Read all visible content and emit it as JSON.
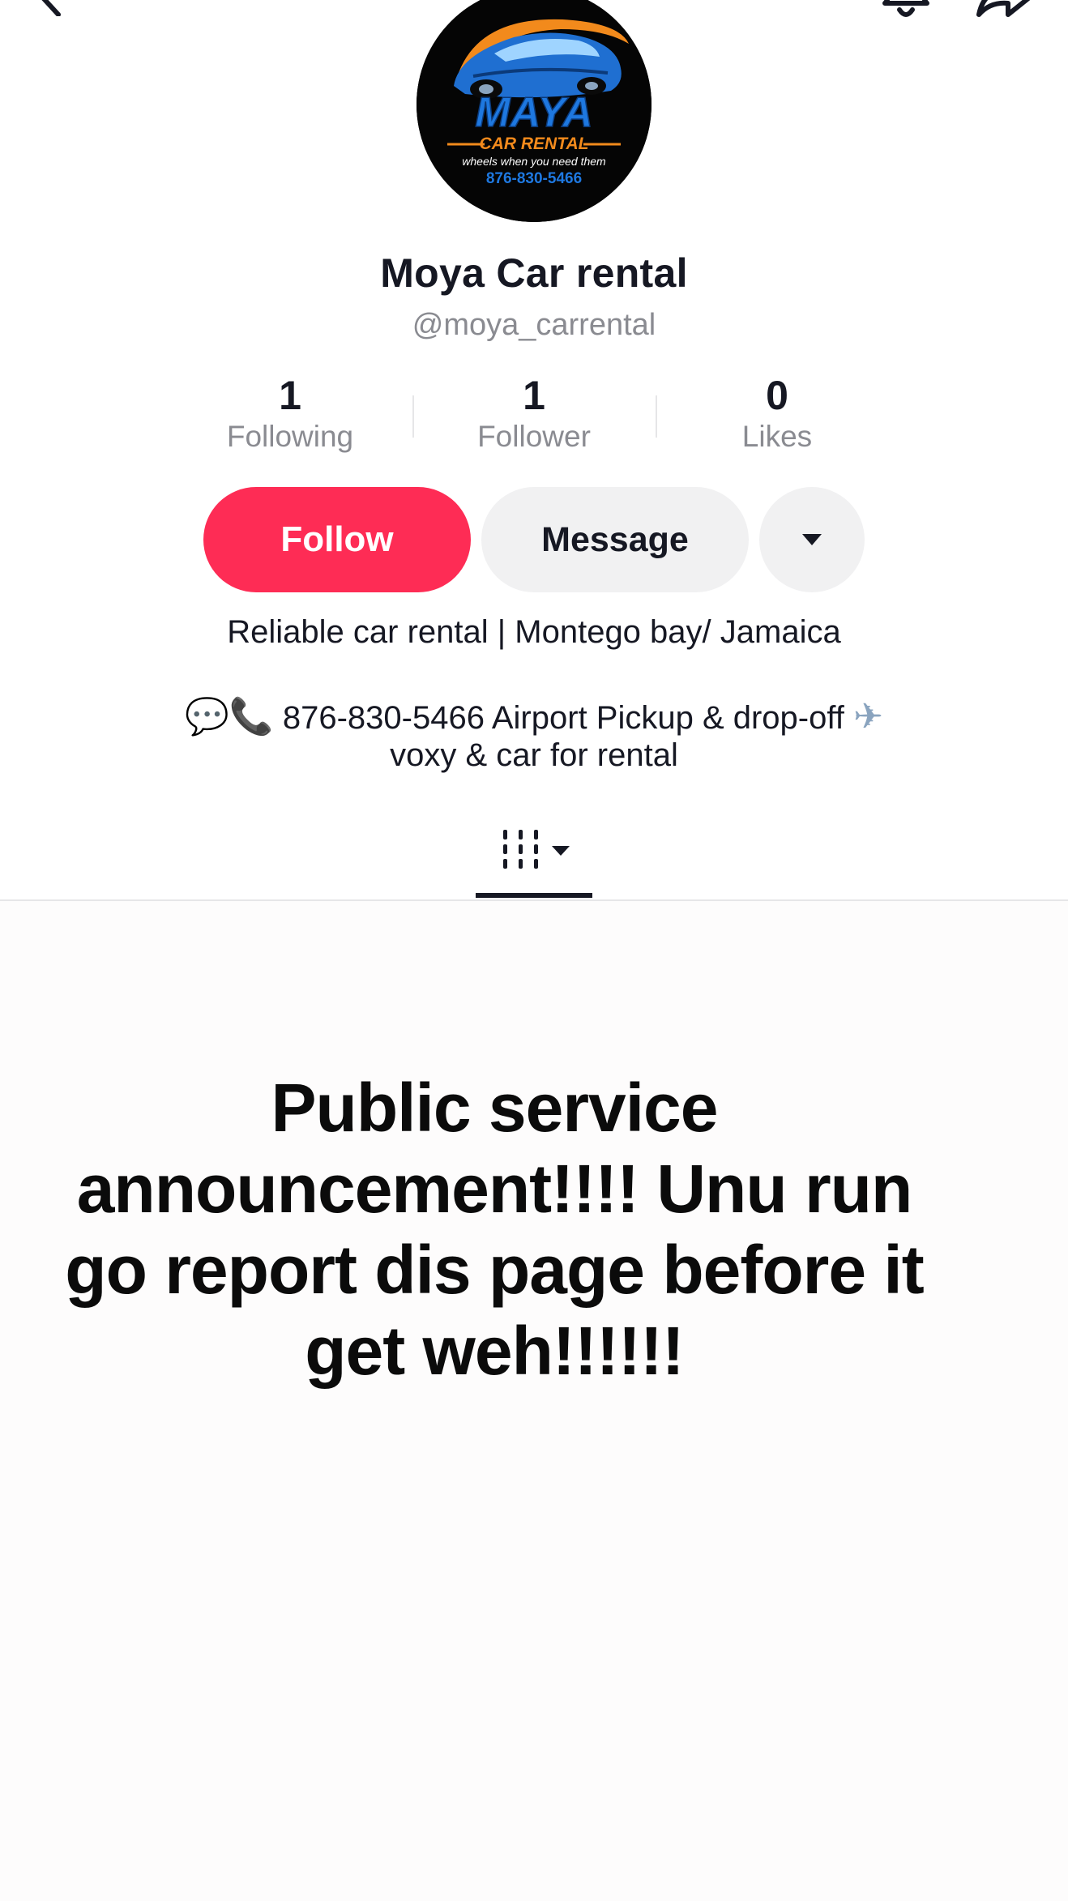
{
  "nav": {
    "back_icon": "chevron-left-icon",
    "bell_icon": "bell-icon",
    "share_icon": "share-icon"
  },
  "avatar": {
    "brand_name": "MAYA",
    "subtitle": "CAR RENTAL",
    "tagline": "wheels when you need them",
    "phone": "876-830-5466"
  },
  "profile": {
    "display_name": "Moya Car rental",
    "handle": "@moya_carrental"
  },
  "stats": [
    {
      "value": "1",
      "label": "Following"
    },
    {
      "value": "1",
      "label": "Follower"
    },
    {
      "value": "0",
      "label": "Likes"
    }
  ],
  "actions": {
    "follow_label": "Follow",
    "message_label": "Message",
    "more_icon": "caret-down-icon"
  },
  "bio": {
    "line1": "Reliable car rental | Montego bay/ Jamaica",
    "line2_text": " 876-830-5466 Airport Pickup & drop-off ",
    "line3": "voxy & car for rental",
    "emoji_bubble": "💬",
    "emoji_phone": "📞",
    "emoji_plane": "✈"
  },
  "tabs": {
    "videos_icon": "grid-columns-icon",
    "dropdown_icon": "caret-down-icon"
  },
  "post": {
    "text": "Public service announcement!!!! Unu run go report dis page before it get weh!!!!!!"
  },
  "colors": {
    "follow": "#fe2c55",
    "button_grey": "#f1f1f2",
    "text_primary": "#161823",
    "text_secondary": "#8a8b91",
    "logo_blue": "#1e78e0",
    "logo_orange": "#f28a1c"
  }
}
